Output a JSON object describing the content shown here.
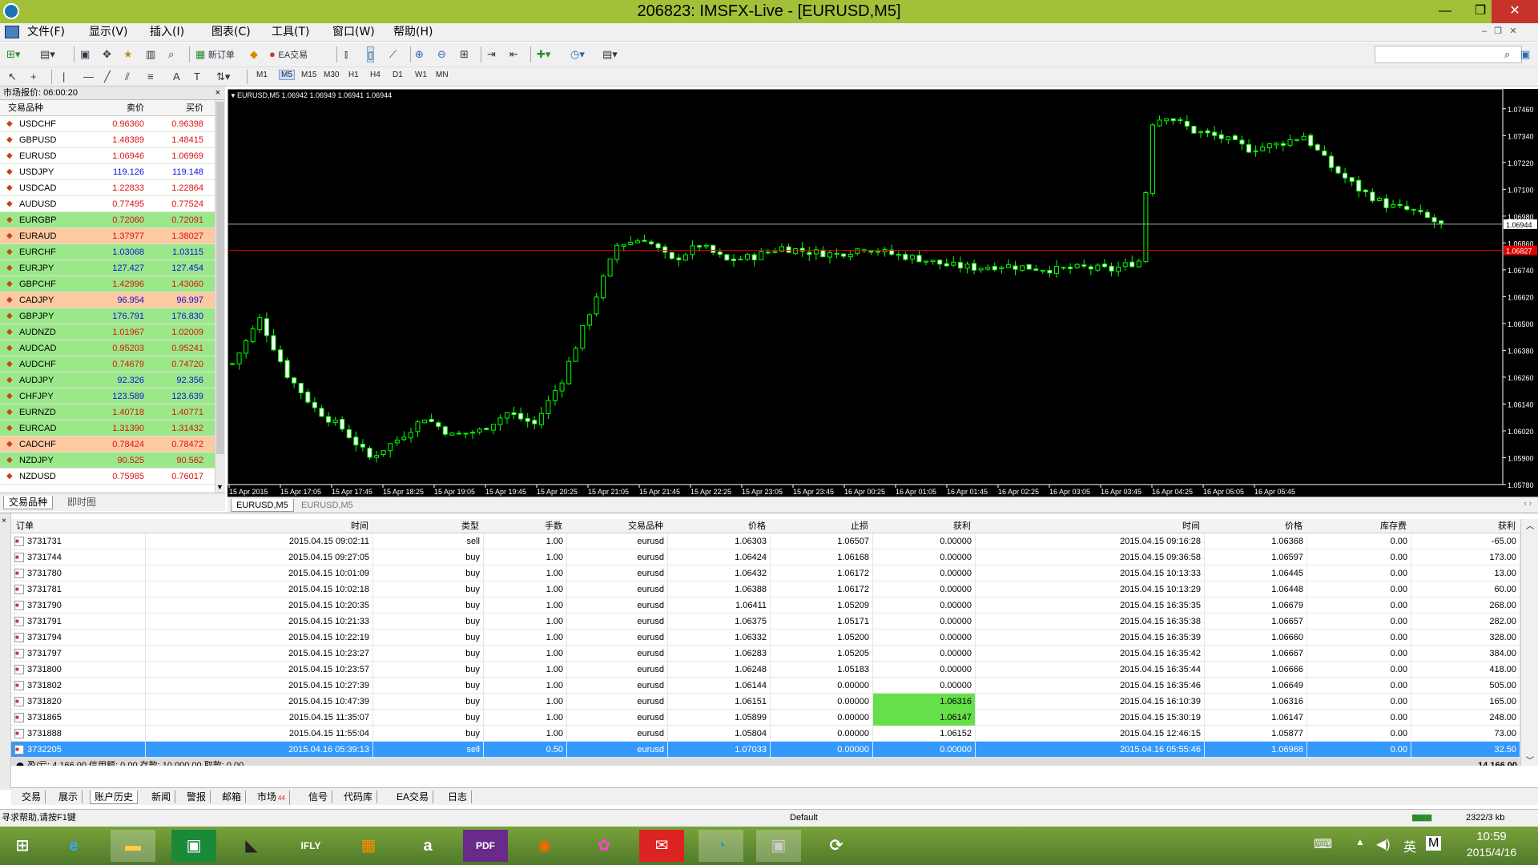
{
  "window": {
    "title": "206823: IMSFX-Live - [EURUSD,M5]",
    "minimize_label": "—",
    "maximize_label": "❐",
    "close_label": "✕"
  },
  "menu": [
    "文件(F)",
    "显示(V)",
    "插入(I)",
    "图表(C)",
    "工具(T)",
    "窗口(W)",
    "帮助(H)"
  ],
  "toolbar": {
    "new_order_label": "新订单",
    "ea_trade_label": "EA交易",
    "timeframes": [
      "M1",
      "M5",
      "M15",
      "M30",
      "H1",
      "H4",
      "D1",
      "W1",
      "MN"
    ],
    "active_timeframe": "M5"
  },
  "market_watch": {
    "title": "市场报价: 06:00:20",
    "headers": {
      "symbol": "交易品种",
      "bid": "卖价",
      "ask": "买价"
    },
    "rows": [
      {
        "symbol": "USDCHF",
        "bid": "0.96360",
        "ask": "0.96398",
        "trend": "down"
      },
      {
        "symbol": "GBPUSD",
        "bid": "1.48389",
        "ask": "1.48415",
        "trend": "down"
      },
      {
        "symbol": "EURUSD",
        "bid": "1.06946",
        "ask": "1.06969",
        "trend": "down"
      },
      {
        "symbol": "USDJPY",
        "bid": "119.126",
        "ask": "119.148",
        "trend": "up"
      },
      {
        "symbol": "USDCAD",
        "bid": "1.22833",
        "ask": "1.22864",
        "trend": "down"
      },
      {
        "symbol": "AUDUSD",
        "bid": "0.77495",
        "ask": "0.77524",
        "trend": "down"
      },
      {
        "symbol": "EURGBP",
        "bid": "0.72060",
        "ask": "0.72091",
        "trend": "down",
        "highlight": "green"
      },
      {
        "symbol": "EURAUD",
        "bid": "1.37977",
        "ask": "1.38027",
        "trend": "down",
        "highlight": "orange"
      },
      {
        "symbol": "EURCHF",
        "bid": "1.03068",
        "ask": "1.03115",
        "trend": "up",
        "highlight": "green"
      },
      {
        "symbol": "EURJPY",
        "bid": "127.427",
        "ask": "127.454",
        "trend": "up",
        "highlight": "green"
      },
      {
        "symbol": "GBPCHF",
        "bid": "1.42996",
        "ask": "1.43060",
        "trend": "down",
        "highlight": "green"
      },
      {
        "symbol": "CADJPY",
        "bid": "96.954",
        "ask": "96.997",
        "trend": "up",
        "highlight": "orange"
      },
      {
        "symbol": "GBPJPY",
        "bid": "176.791",
        "ask": "176.830",
        "trend": "up",
        "highlight": "green"
      },
      {
        "symbol": "AUDNZD",
        "bid": "1.01967",
        "ask": "1.02009",
        "trend": "down",
        "highlight": "green"
      },
      {
        "symbol": "AUDCAD",
        "bid": "0.95203",
        "ask": "0.95241",
        "trend": "down",
        "highlight": "green"
      },
      {
        "symbol": "AUDCHF",
        "bid": "0.74679",
        "ask": "0.74720",
        "trend": "down",
        "highlight": "green"
      },
      {
        "symbol": "AUDJPY",
        "bid": "92.326",
        "ask": "92.356",
        "trend": "up",
        "highlight": "green"
      },
      {
        "symbol": "CHFJPY",
        "bid": "123.589",
        "ask": "123.639",
        "trend": "up",
        "highlight": "green"
      },
      {
        "symbol": "EURNZD",
        "bid": "1.40718",
        "ask": "1.40771",
        "trend": "down",
        "highlight": "green"
      },
      {
        "symbol": "EURCAD",
        "bid": "1.31390",
        "ask": "1.31432",
        "trend": "down",
        "highlight": "green"
      },
      {
        "symbol": "CADCHF",
        "bid": "0.78424",
        "ask": "0.78472",
        "trend": "down",
        "highlight": "orange"
      },
      {
        "symbol": "NZDJPY",
        "bid": "90.525",
        "ask": "90.562",
        "trend": "down",
        "highlight": "green"
      },
      {
        "symbol": "NZDUSD",
        "bid": "0.75985",
        "ask": "0.76017",
        "trend": "down"
      }
    ],
    "tabs": [
      "交易品种",
      "即时图"
    ]
  },
  "chart": {
    "info": "EURUSD,M5  1.06942 1.06949 1.06941 1.06944",
    "price_labels": [
      "1.07460",
      "1.07340",
      "1.07220",
      "1.07100",
      "1.06980",
      "1.06860",
      "1.06740",
      "1.06620",
      "1.06500",
      "1.06380",
      "1.06260",
      "1.06140",
      "1.06020",
      "1.05900",
      "1.05780"
    ],
    "current_price": "1.06944",
    "red_line_price": "1.06827",
    "time_labels": [
      "15 Apr 2015",
      "15 Apr 17:05",
      "15 Apr 17:45",
      "15 Apr 18:25",
      "15 Apr 19:05",
      "15 Apr 19:45",
      "15 Apr 20:25",
      "15 Apr 21:05",
      "15 Apr 21:45",
      "15 Apr 22:25",
      "15 Apr 23:05",
      "15 Apr 23:45",
      "16 Apr 00:25",
      "16 Apr 01:05",
      "16 Apr 01:45",
      "16 Apr 02:25",
      "16 Apr 03:05",
      "16 Apr 03:45",
      "16 Apr 04:25",
      "16 Apr 05:05",
      "16 Apr 05:45"
    ],
    "tabs": [
      "EURUSD,M5",
      "EURUSD,M5"
    ]
  },
  "chart_data": {
    "type": "candlestick",
    "symbol": "EURUSD",
    "timeframe": "M5",
    "ylim": [
      1.0578,
      1.0752
    ],
    "close_path": [
      [
        0,
        1.0632
      ],
      [
        4,
        1.0652
      ],
      [
        8,
        1.0627
      ],
      [
        12,
        1.0612
      ],
      [
        16,
        1.0603
      ],
      [
        20,
        1.059
      ],
      [
        24,
        1.0598
      ],
      [
        28,
        1.0608
      ],
      [
        32,
        1.06
      ],
      [
        36,
        1.0602
      ],
      [
        40,
        1.061
      ],
      [
        44,
        1.0605
      ],
      [
        48,
        1.0625
      ],
      [
        52,
        1.0655
      ],
      [
        56,
        1.0685
      ],
      [
        60,
        1.0688
      ],
      [
        64,
        1.0678
      ],
      [
        68,
        1.0685
      ],
      [
        72,
        1.0678
      ],
      [
        76,
        1.068
      ],
      [
        80,
        1.0684
      ],
      [
        84,
        1.0682
      ],
      [
        88,
        1.0681
      ],
      [
        92,
        1.0684
      ],
      [
        96,
        1.0681
      ],
      [
        100,
        1.0679
      ],
      [
        104,
        1.0676
      ],
      [
        108,
        1.0675
      ],
      [
        112,
        1.0676
      ],
      [
        116,
        1.0675
      ],
      [
        120,
        1.0674
      ],
      [
        124,
        1.0675
      ],
      [
        128,
        1.0674
      ],
      [
        132,
        1.0678
      ],
      [
        134,
        1.074
      ],
      [
        136,
        1.0743
      ],
      [
        140,
        1.0736
      ],
      [
        144,
        1.0733
      ],
      [
        148,
        1.0728
      ],
      [
        152,
        1.073
      ],
      [
        156,
        1.0734
      ],
      [
        160,
        1.072
      ],
      [
        164,
        1.071
      ],
      [
        168,
        1.0703
      ],
      [
        172,
        1.07
      ],
      [
        176,
        1.0694
      ]
    ]
  },
  "terminal": {
    "headers": [
      "订单",
      "时间",
      "类型",
      "手数",
      "交易品种",
      "价格",
      "止损",
      "获利",
      "时间",
      "价格",
      "库存费",
      "获利"
    ],
    "rows": [
      [
        "3731731",
        "2015.04.15 09:02:11",
        "sell",
        "1.00",
        "eurusd",
        "1.06303",
        "1.06507",
        "0.00000",
        "2015.04.15 09:16:28",
        "1.06368",
        "0.00",
        "-65.00"
      ],
      [
        "3731744",
        "2015.04.15 09:27:05",
        "buy",
        "1.00",
        "eurusd",
        "1.06424",
        "1.06168",
        "0.00000",
        "2015.04.15 09:36:58",
        "1.06597",
        "0.00",
        "173.00"
      ],
      [
        "3731780",
        "2015.04.15 10:01:09",
        "buy",
        "1.00",
        "eurusd",
        "1.06432",
        "1.06172",
        "0.00000",
        "2015.04.15 10:13:33",
        "1.06445",
        "0.00",
        "13.00"
      ],
      [
        "3731781",
        "2015.04.15 10:02:18",
        "buy",
        "1.00",
        "eurusd",
        "1.06388",
        "1.06172",
        "0.00000",
        "2015.04.15 10:13:29",
        "1.06448",
        "0.00",
        "60.00"
      ],
      [
        "3731790",
        "2015.04.15 10:20:35",
        "buy",
        "1.00",
        "eurusd",
        "1.06411",
        "1.05209",
        "0.00000",
        "2015.04.15 16:35:35",
        "1.06679",
        "0.00",
        "268.00"
      ],
      [
        "3731791",
        "2015.04.15 10:21:33",
        "buy",
        "1.00",
        "eurusd",
        "1.06375",
        "1.05171",
        "0.00000",
        "2015.04.15 16:35:38",
        "1.06657",
        "0.00",
        "282.00"
      ],
      [
        "3731794",
        "2015.04.15 10:22:19",
        "buy",
        "1.00",
        "eurusd",
        "1.06332",
        "1.05200",
        "0.00000",
        "2015.04.15 16:35:39",
        "1.06660",
        "0.00",
        "328.00"
      ],
      [
        "3731797",
        "2015.04.15 10:23:27",
        "buy",
        "1.00",
        "eurusd",
        "1.06283",
        "1.05205",
        "0.00000",
        "2015.04.15 16:35:42",
        "1.06667",
        "0.00",
        "384.00"
      ],
      [
        "3731800",
        "2015.04.15 10:23:57",
        "buy",
        "1.00",
        "eurusd",
        "1.06248",
        "1.05183",
        "0.00000",
        "2015.04.15 16:35:44",
        "1.06666",
        "0.00",
        "418.00"
      ],
      [
        "3731802",
        "2015.04.15 10:27:39",
        "buy",
        "1.00",
        "eurusd",
        "1.06144",
        "0.00000",
        "0.00000",
        "2015.04.15 16:35:46",
        "1.06649",
        "0.00",
        "505.00"
      ],
      [
        "3731820",
        "2015.04.15 10:47:39",
        "buy",
        "1.00",
        "eurusd",
        "1.06151",
        "0.00000",
        "1.06316",
        "2015.04.15 16:10:39",
        "1.06316",
        "0.00",
        "165.00"
      ],
      [
        "3731865",
        "2015.04.15 11:35:07",
        "buy",
        "1.00",
        "eurusd",
        "1.05899",
        "0.00000",
        "1.06147",
        "2015.04.15 15:30:19",
        "1.06147",
        "0.00",
        "248.00"
      ],
      [
        "3731888",
        "2015.04.15 11:55:04",
        "buy",
        "1.00",
        "eurusd",
        "1.05804",
        "0.00000",
        "1.06152",
        "2015.04.15 12:46:15",
        "1.05877",
        "0.00",
        "73.00"
      ],
      [
        "3732205",
        "2015.04.16 05:39:13",
        "sell",
        "0.50",
        "eurusd",
        "1.07033",
        "0.00000",
        "0.00000",
        "2015.04.16 05:55:46",
        "1.06968",
        "0.00",
        "32.50"
      ]
    ],
    "highlight_tp_rows": [
      10,
      11
    ],
    "selected_row": 13,
    "summary": "盈/亏: 4 166.00  信用额: 0.00  存款: 10 000.00  取款: 0.00",
    "summary_total": "14 166.00",
    "tabs": [
      "交易",
      "展示",
      "账户历史",
      "新闻",
      "警报",
      "邮箱",
      "市场",
      "信号",
      "代码库",
      "EA交易",
      "日志"
    ],
    "market_badge": "44",
    "active_tab": "账户历史"
  },
  "statusbar": {
    "help": "寻求帮助,请按F1键",
    "profile": "Default",
    "traffic": "2322/3 kb"
  },
  "taskbar": {
    "clock_time": "10:59",
    "clock_date": "2015/4/16",
    "ime": "英",
    "ime2": "M"
  }
}
